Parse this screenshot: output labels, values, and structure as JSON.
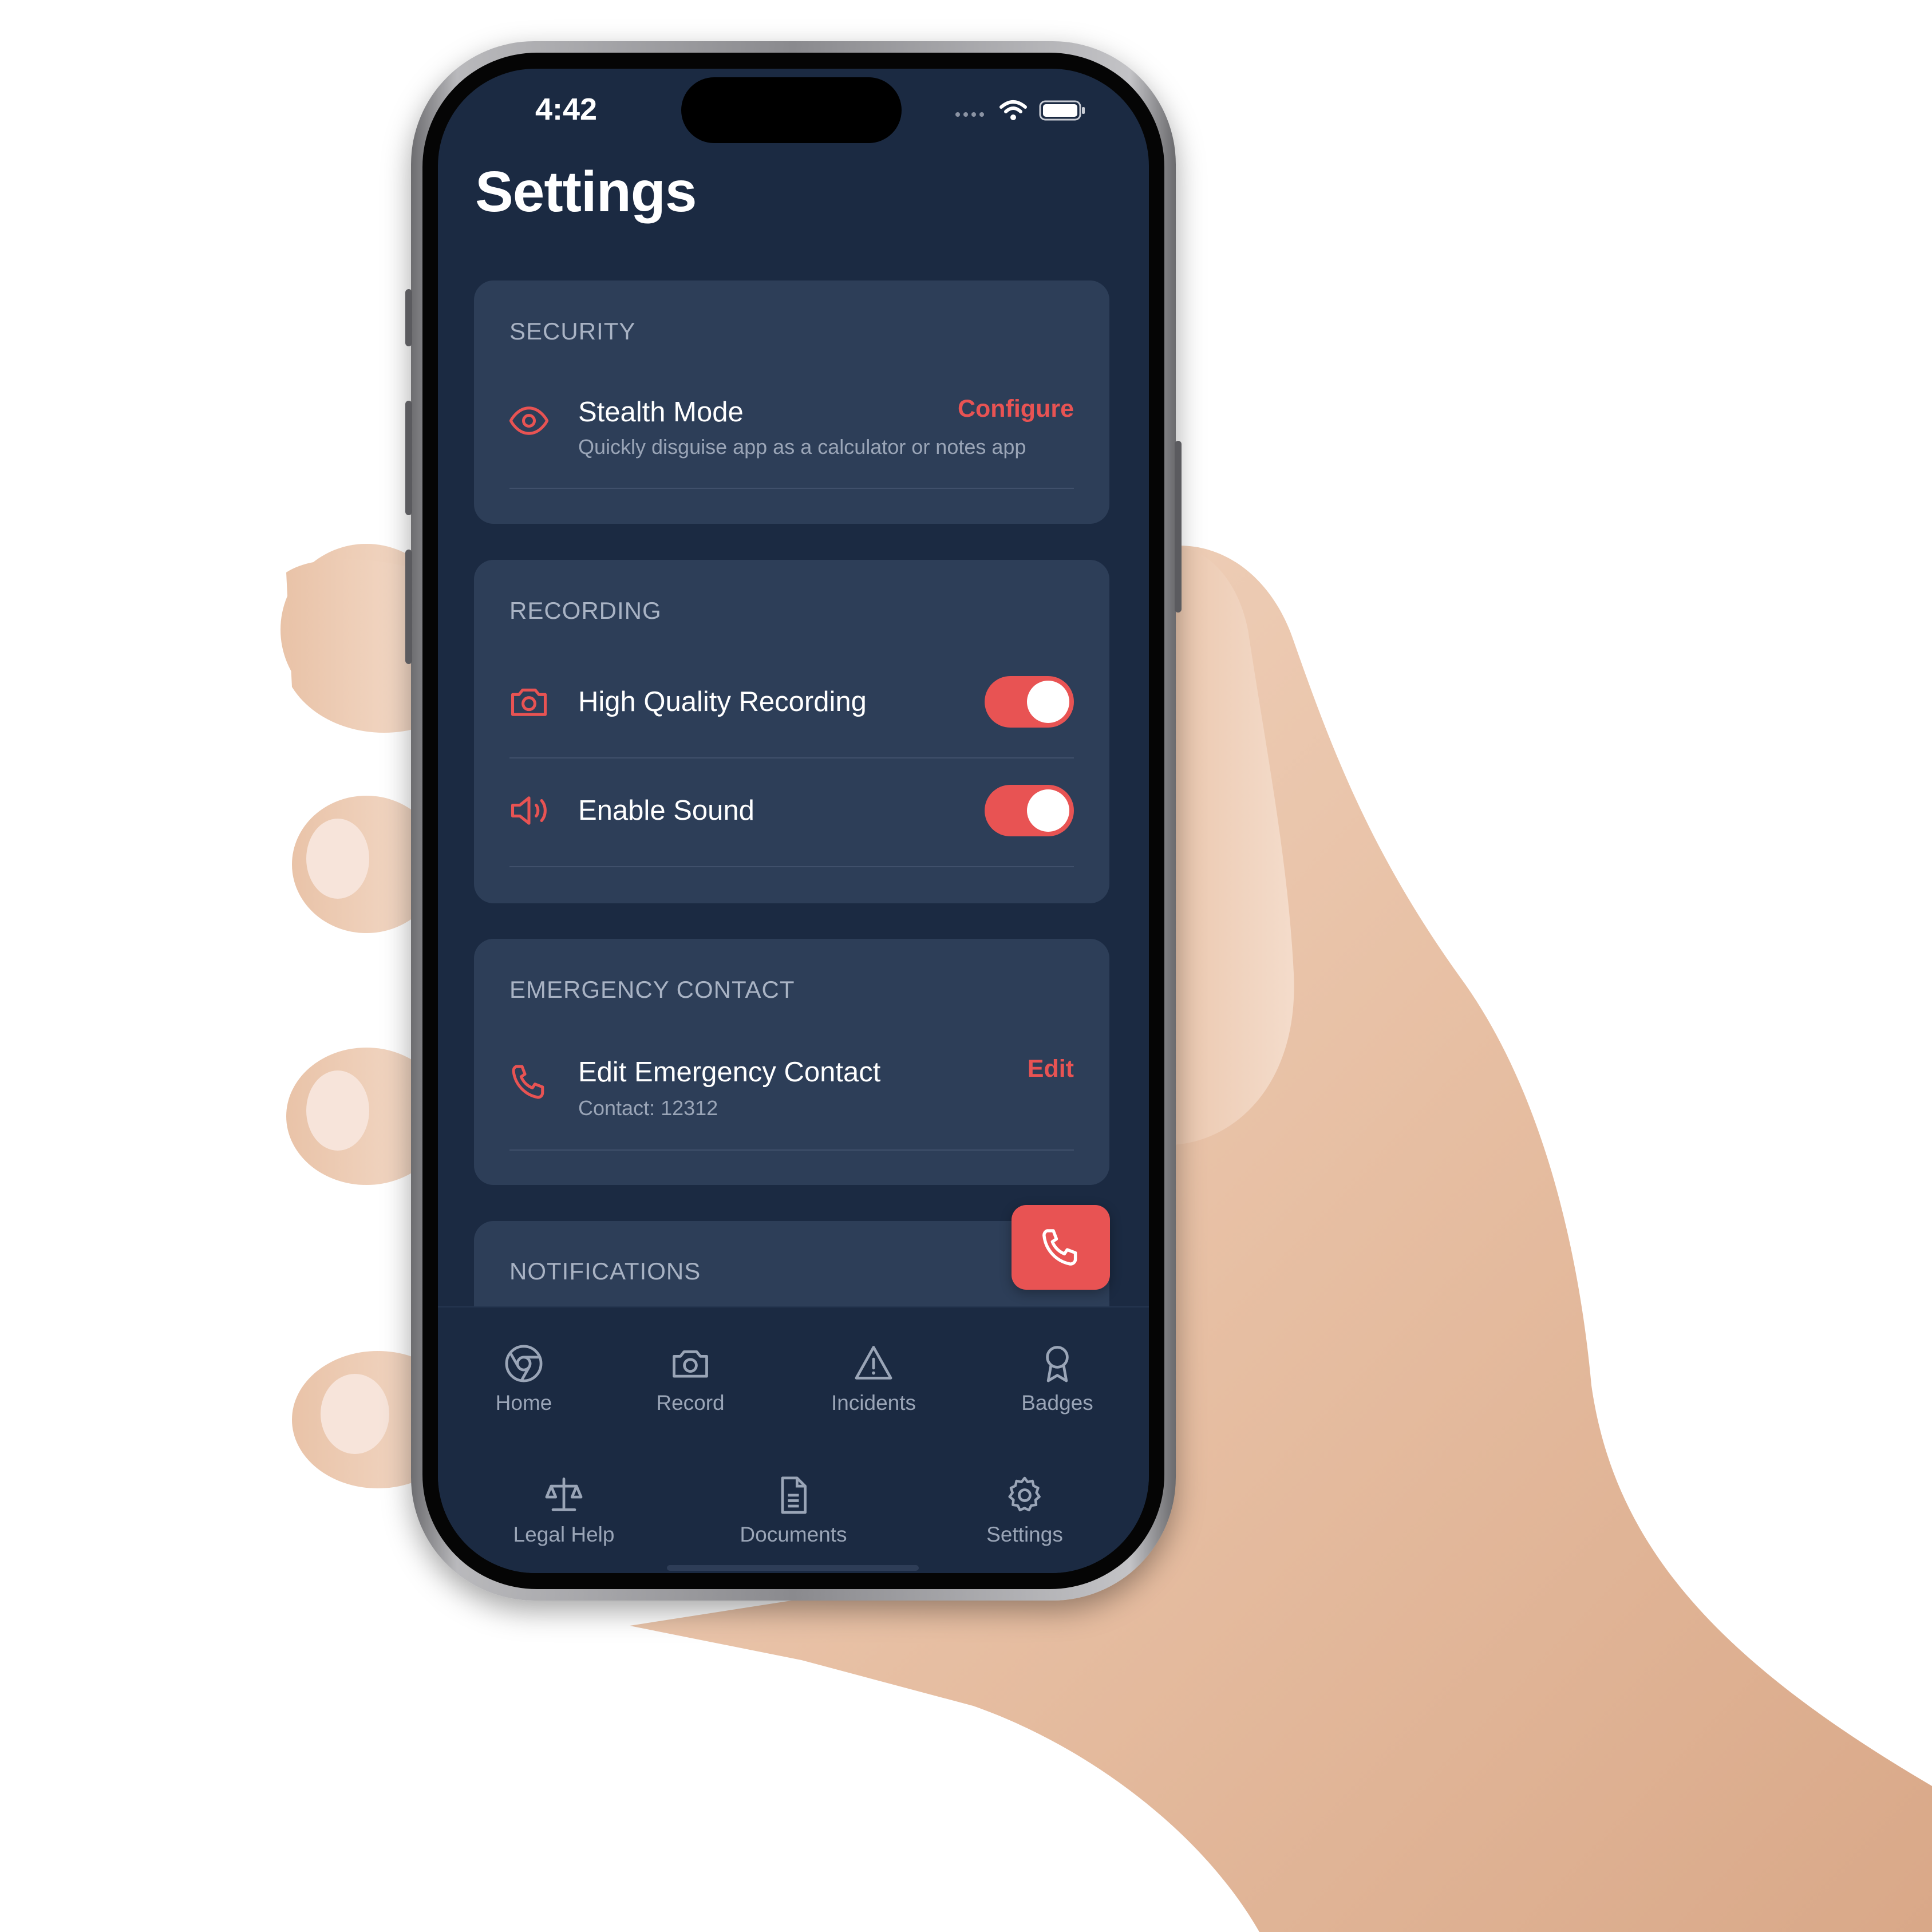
{
  "status_bar": {
    "time": "4:42"
  },
  "page": {
    "title": "Settings"
  },
  "sections": {
    "security": {
      "label": "SECURITY",
      "stealth": {
        "icon": "eye-icon",
        "title": "Stealth Mode",
        "subtitle": "Quickly disguise app as a calculator or notes app",
        "action": "Configure"
      }
    },
    "recording": {
      "label": "RECORDING",
      "high_quality": {
        "icon": "camera-icon",
        "title": "High Quality Recording",
        "enabled": true
      },
      "sound": {
        "icon": "speaker-icon",
        "title": "Enable Sound",
        "enabled": true
      }
    },
    "emergency": {
      "label": "EMERGENCY CONTACT",
      "contact": {
        "icon": "phone-icon",
        "title": "Edit Emergency Contact",
        "subtitle": "Contact: 12312",
        "action": "Edit"
      }
    },
    "notifications": {
      "label": "NOTIFICATIONS"
    }
  },
  "fab": {
    "icon": "phone-icon"
  },
  "tabs": {
    "row1": [
      {
        "label": "Home",
        "icon": "chrome-icon"
      },
      {
        "label": "Record",
        "icon": "camera-icon"
      },
      {
        "label": "Incidents",
        "icon": "alert-triangle-icon"
      },
      {
        "label": "Badges",
        "icon": "award-icon"
      }
    ],
    "row2": [
      {
        "label": "Legal Help",
        "icon": "scale-icon"
      },
      {
        "label": "Documents",
        "icon": "document-icon"
      },
      {
        "label": "Settings",
        "icon": "gear-icon"
      }
    ]
  },
  "colors": {
    "background": "#1b2a42",
    "card": "#2d3e58",
    "accent": "#e85353",
    "muted_text": "#9aa5b7"
  }
}
